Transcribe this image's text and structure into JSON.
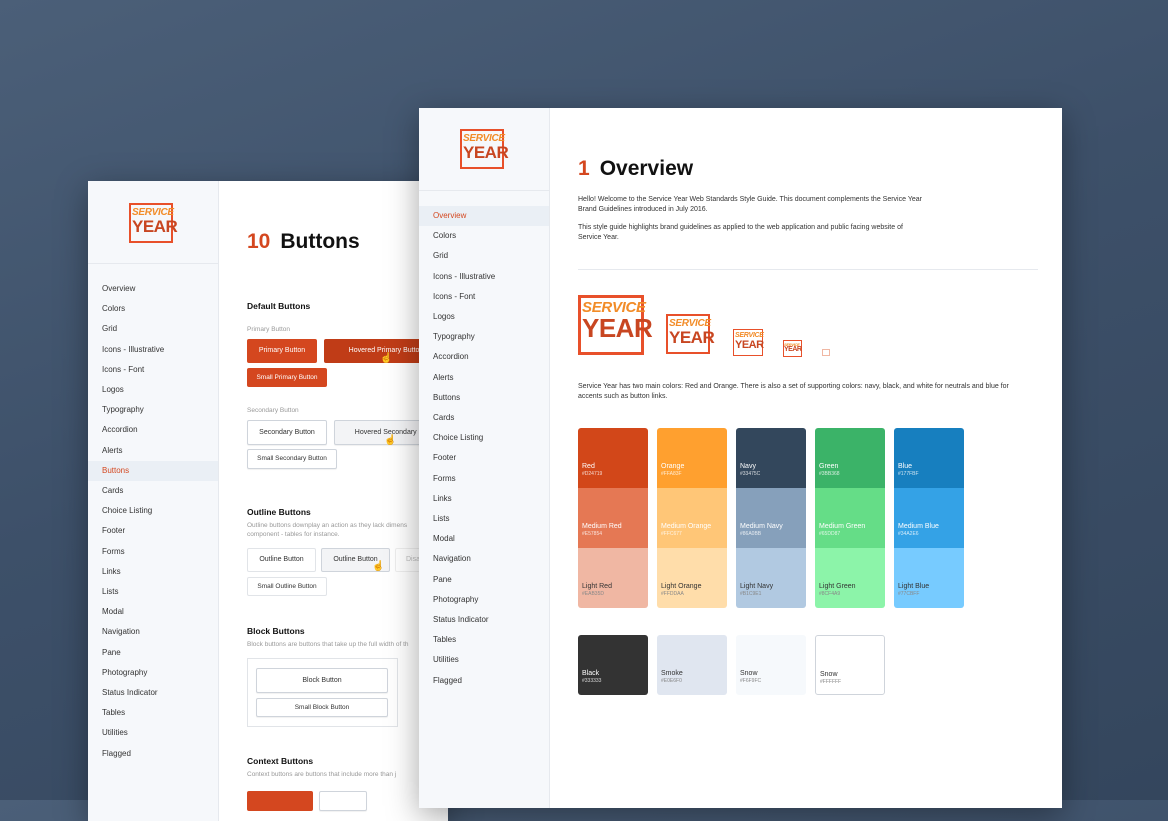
{
  "brand": {
    "logo_line1": "SERVICE",
    "logo_line2": "YEAR",
    "red": "#d4471f",
    "orange": "#f28c28"
  },
  "left_page": {
    "section_number": "10",
    "section_title": "Buttons",
    "nav": [
      "Overview",
      "Colors",
      "Grid",
      "Icons - Illustrative",
      "Icons - Font",
      "Logos",
      "Typography",
      "Accordion",
      "Alerts",
      "Buttons",
      "Cards",
      "Choice Listing",
      "Footer",
      "Forms",
      "Links",
      "Lists",
      "Modal",
      "Navigation",
      "Pane",
      "Photography",
      "Status Indicator",
      "Tables",
      "Utilities",
      "Flagged"
    ],
    "active_nav": "Buttons",
    "default_buttons": {
      "heading": "Default Buttons",
      "primary_label": "Primary Button",
      "primary": "Primary Button",
      "primary_hover": "Hovered Primary Button",
      "primary_small": "Small Primary Button",
      "secondary_label": "Secondary Button",
      "secondary": "Secondary Button",
      "secondary_hover": "Hovered Secondary Bu",
      "secondary_small": "Small Secondary Button"
    },
    "outline_buttons": {
      "heading": "Outline Buttons",
      "desc1": "Outline buttons downplay an action as they lack dimens",
      "desc2": "component - tables for instance.",
      "outline": "Outline Button",
      "outline_hover": "Outline Button",
      "disabled": "Disa",
      "outline_small": "Small Outline Button"
    },
    "block_buttons": {
      "heading": "Block Buttons",
      "desc": "Block buttons are buttons that take up the full width of th",
      "block": "Block Button",
      "block_small": "Small Block Button"
    },
    "context_buttons": {
      "heading": "Context Buttons",
      "desc": "Context buttons are buttons that include more than j"
    }
  },
  "right_page": {
    "section_number": "1",
    "section_title": "Overview",
    "nav": [
      "Overview",
      "Colors",
      "Grid",
      "Icons - Illustrative",
      "Icons - Font",
      "Logos",
      "Typography",
      "Accordion",
      "Alerts",
      "Buttons",
      "Cards",
      "Choice Listing",
      "Footer",
      "Forms",
      "Links",
      "Lists",
      "Modal",
      "Navigation",
      "Pane",
      "Photography",
      "Status Indicator",
      "Tables",
      "Utilities",
      "Flagged"
    ],
    "active_nav": "Overview",
    "intro_1a": "Hello! Welcome to the Service Year Web Standards Style Guide.  This document complements the Service Year",
    "intro_1b": "Brand Guidelines introduced in July 2016.",
    "intro_2a": "This style guide highlights brand guidelines as applied to the web application and public facing website of",
    "intro_2b": "Service Year.",
    "colors_text_a": "Service Year has two main colors: Red and Orange. There is also a set of supporting colors: navy, black, and white for neutrals and blue for",
    "colors_text_b": "accents such as button links.",
    "color_columns": [
      [
        {
          "name": "Red",
          "hex": "#D24719",
          "color": "#d24719"
        },
        {
          "name": "Medium Red",
          "hex": "#E57854",
          "color": "#e57854"
        },
        {
          "name": "Light Red",
          "hex": "#EAB35D",
          "color": "#f0b7a3"
        }
      ],
      [
        {
          "name": "Orange",
          "hex": "#FFA83F",
          "color": "#ffa02f"
        },
        {
          "name": "Medium Orange",
          "hex": "#FFC677",
          "color": "#ffc677"
        },
        {
          "name": "Light Orange",
          "hex": "#FFDDAA",
          "color": "#ffddaa"
        }
      ],
      [
        {
          "name": "Navy",
          "hex": "#33475C",
          "color": "#33475c"
        },
        {
          "name": "Medium Navy",
          "hex": "#86A0BB",
          "color": "#86a0bb"
        },
        {
          "name": "Light Navy",
          "hex": "#B1C9E1",
          "color": "#b1c9e1"
        }
      ],
      [
        {
          "name": "Green",
          "hex": "#3BB368",
          "color": "#3bb368"
        },
        {
          "name": "Medium Green",
          "hex": "#65DD87",
          "color": "#65dd87"
        },
        {
          "name": "Light Green",
          "hex": "#8CF4A9",
          "color": "#8cf4a9"
        }
      ],
      [
        {
          "name": "Blue",
          "hex": "#177FBF",
          "color": "#177fbf"
        },
        {
          "name": "Medium Blue",
          "hex": "#34A2E6",
          "color": "#34a2e6"
        },
        {
          "name": "Light Blue",
          "hex": "#77CBFF",
          "color": "#77cbff"
        }
      ]
    ],
    "neutral_colors": [
      {
        "name": "Black",
        "hex": "#333333",
        "color": "#333333"
      },
      {
        "name": "Smoke",
        "hex": "#E0E6F0",
        "color": "#e0e6f0"
      },
      {
        "name": "Snow",
        "hex": "#F6F9FC",
        "color": "#f6f9fc"
      },
      {
        "name": "Snow",
        "hex": "#FFFFFF",
        "color": "#ffffff"
      }
    ]
  }
}
